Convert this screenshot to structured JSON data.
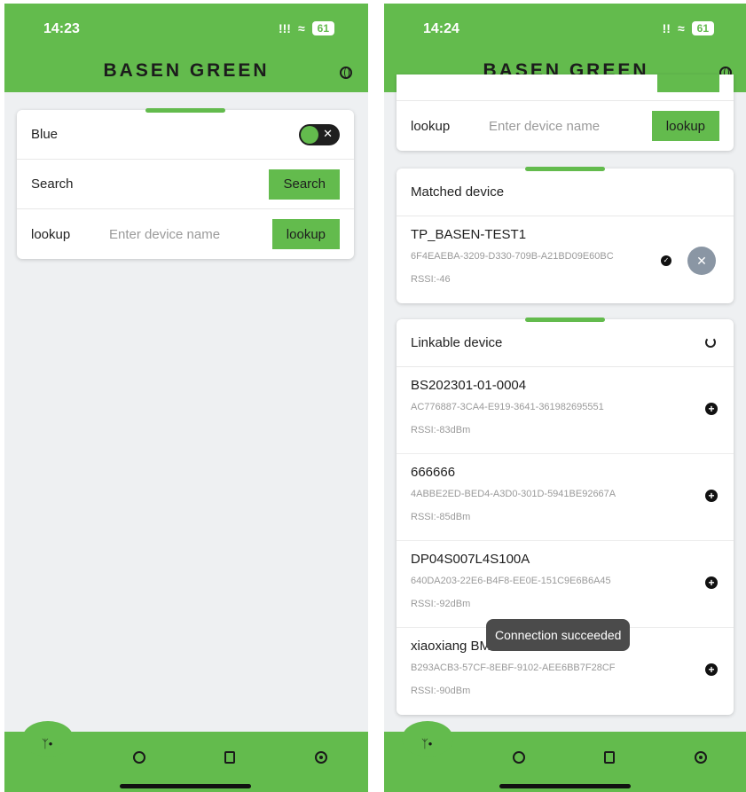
{
  "left": {
    "status": {
      "time": "14:23",
      "signal": "!!!",
      "battery": "61"
    },
    "header": {
      "logo": "BASEN GREEN"
    },
    "settings": {
      "blue_label": "Blue",
      "search_label": "Search",
      "search_button": "Search",
      "lookup_label": "lookup",
      "lookup_placeholder": "Enter device name",
      "lookup_button": "lookup"
    }
  },
  "right": {
    "status": {
      "time": "14:24",
      "signal": "!!",
      "battery": "61"
    },
    "header": {
      "logo": "BASEN GREEN"
    },
    "lookup": {
      "label": "lookup",
      "placeholder": "Enter device name",
      "button": "lookup"
    },
    "matched": {
      "title": "Matched device",
      "device": {
        "name": "TP_BASEN-TEST1",
        "id": "6F4EAEBA-3209-D330-709B-A21BD09E60BC",
        "rssi": "RSSI:-46"
      }
    },
    "linkable": {
      "title": "Linkable device",
      "devices": [
        {
          "name": "BS202301-01-0004",
          "id": "AC776887-3CA4-E919-3641-361982695551",
          "rssi": "RSSI:-83dBm"
        },
        {
          "name": "666666",
          "id": "4ABBE2ED-BED4-A3D0-301D-5941BE92667A",
          "rssi": "RSSI:-85dBm"
        },
        {
          "name": "DP04S007L4S100A",
          "id": "640DA203-22E6-B4F8-EE0E-151C9E6B6A45",
          "rssi": "RSSI:-92dBm"
        },
        {
          "name": "xiaoxiang BMS",
          "id": "B293ACB3-57CF-8EBF-9102-AEE6BB7F28CF",
          "rssi": "RSSI:-90dBm"
        }
      ]
    },
    "toast": "Connection succeeded"
  },
  "colors": {
    "brand_green": "#63bb4d",
    "background": "#eef0f2",
    "close_button": "#8a96a4"
  },
  "icons": [
    "bell-muted-icon",
    "wifi-icon",
    "battery-icon",
    "globe-icon",
    "bluetooth-icon",
    "refresh-icon",
    "document-icon",
    "settings-icon",
    "check-circle-icon",
    "close-icon",
    "plus-circle-icon",
    "spinner-icon"
  ]
}
